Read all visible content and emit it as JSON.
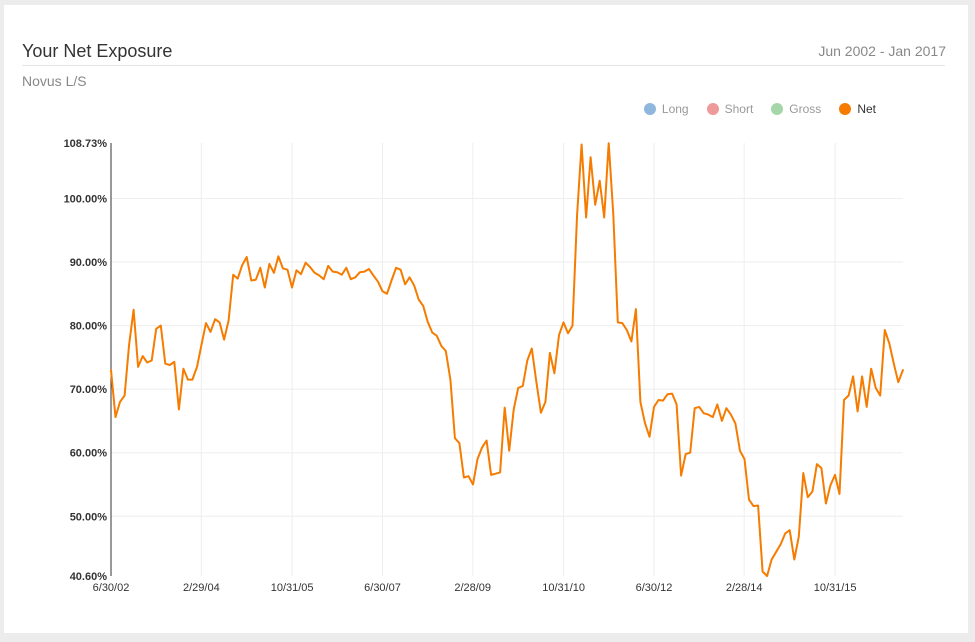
{
  "header": {
    "title": "Your Net Exposure",
    "date_range": "Jun 2002 - Jan 2017",
    "subtitle": "Novus L/S"
  },
  "legend": [
    {
      "label": "Long",
      "color": "#8fb6dd",
      "active": false
    },
    {
      "label": "Short",
      "color": "#ef9a9a",
      "active": false
    },
    {
      "label": "Gross",
      "color": "#a5d6a7",
      "active": false
    },
    {
      "label": "Net",
      "color": "#f57c00",
      "active": true
    }
  ],
  "chart_data": {
    "type": "line",
    "y_ticks": [
      "108.73%",
      "100.00%",
      "90.00%",
      "80.00%",
      "70.00%",
      "60.00%",
      "50.00%",
      "40.60%"
    ],
    "y_tick_values": [
      108.73,
      100,
      90,
      80,
      70,
      60,
      50,
      40.6
    ],
    "ylim": [
      40.6,
      108.73
    ],
    "x_ticks": [
      "6/30/02",
      "2/29/04",
      "10/31/05",
      "6/30/07",
      "2/28/09",
      "10/31/10",
      "6/30/12",
      "2/28/14",
      "10/31/15"
    ],
    "xlim": [
      "2002-06-30",
      "2017-01-31"
    ],
    "grid": true,
    "series": [
      {
        "name": "Net",
        "color": "#f57c00",
        "x": [
          "2002-06",
          "2002-07",
          "2002-08",
          "2002-09",
          "2002-10",
          "2002-11",
          "2002-12",
          "2003-01",
          "2003-02",
          "2003-03",
          "2003-04",
          "2003-05",
          "2003-06",
          "2003-07",
          "2003-08",
          "2003-09",
          "2003-10",
          "2003-11",
          "2003-12",
          "2004-01",
          "2004-02",
          "2004-03",
          "2004-04",
          "2004-05",
          "2004-06",
          "2004-07",
          "2004-08",
          "2004-09",
          "2004-10",
          "2004-11",
          "2004-12",
          "2005-01",
          "2005-02",
          "2005-03",
          "2005-04",
          "2005-05",
          "2005-06",
          "2005-07",
          "2005-08",
          "2005-09",
          "2005-10",
          "2005-11",
          "2005-12",
          "2006-01",
          "2006-02",
          "2006-03",
          "2006-04",
          "2006-05",
          "2006-06",
          "2006-07",
          "2006-08",
          "2006-09",
          "2006-10",
          "2006-11",
          "2006-12",
          "2007-01",
          "2007-02",
          "2007-03",
          "2007-04",
          "2007-05",
          "2007-06",
          "2007-07",
          "2007-08",
          "2007-09",
          "2007-10",
          "2007-11",
          "2007-12",
          "2008-01",
          "2008-02",
          "2008-03",
          "2008-04",
          "2008-05",
          "2008-06",
          "2008-07",
          "2008-08",
          "2008-09",
          "2008-10",
          "2008-11",
          "2008-12",
          "2009-01",
          "2009-02",
          "2009-03",
          "2009-04",
          "2009-05",
          "2009-06",
          "2009-07",
          "2009-08",
          "2009-09",
          "2009-10",
          "2009-11",
          "2009-12",
          "2010-01",
          "2010-02",
          "2010-03",
          "2010-04",
          "2010-05",
          "2010-06",
          "2010-07",
          "2010-08",
          "2010-09",
          "2010-10",
          "2010-11",
          "2010-12",
          "2011-01",
          "2011-02",
          "2011-03",
          "2011-04",
          "2011-05",
          "2011-06",
          "2011-07",
          "2011-08",
          "2011-09",
          "2011-10",
          "2011-11",
          "2011-12",
          "2012-01",
          "2012-02",
          "2012-03",
          "2012-04",
          "2012-05",
          "2012-06",
          "2012-07",
          "2012-08",
          "2012-09",
          "2012-10",
          "2012-11",
          "2012-12",
          "2013-01",
          "2013-02",
          "2013-03",
          "2013-04",
          "2013-05",
          "2013-06",
          "2013-07",
          "2013-08",
          "2013-09",
          "2013-10",
          "2013-11",
          "2013-12",
          "2014-01",
          "2014-02",
          "2014-03",
          "2014-04",
          "2014-05",
          "2014-06",
          "2014-07",
          "2014-08",
          "2014-09",
          "2014-10",
          "2014-11",
          "2014-12",
          "2015-01",
          "2015-02",
          "2015-03",
          "2015-04",
          "2015-05",
          "2015-06",
          "2015-07",
          "2015-08",
          "2015-09",
          "2015-10",
          "2015-11",
          "2015-12",
          "2016-01",
          "2016-02",
          "2016-03",
          "2016-04",
          "2016-05",
          "2016-06",
          "2016-07",
          "2016-08",
          "2016-09",
          "2016-10",
          "2016-11",
          "2016-12",
          "2017-01"
        ],
        "values": [
          73.0,
          65.6,
          68.0,
          69.0,
          77.0,
          82.5,
          73.5,
          75.2,
          74.2,
          74.5,
          79.5,
          80.0,
          74.0,
          73.8,
          74.3,
          66.8,
          73.2,
          71.5,
          71.5,
          73.5,
          77.0,
          80.4,
          79.0,
          81.0,
          80.5,
          77.8,
          80.8,
          88.0,
          87.4,
          89.5,
          90.8,
          87.1,
          87.2,
          89.1,
          86.0,
          89.7,
          88.3,
          90.9,
          89.0,
          88.8,
          86.0,
          88.7,
          88.1,
          89.9,
          89.2,
          88.3,
          87.9,
          87.3,
          89.4,
          88.5,
          88.4,
          88.0,
          89.1,
          87.3,
          87.6,
          88.4,
          88.5,
          88.9,
          87.9,
          86.9,
          85.4,
          85.0,
          87.1,
          89.1,
          88.8,
          86.5,
          87.6,
          86.3,
          84.1,
          83.1,
          80.6,
          78.9,
          78.4,
          76.8,
          76.0,
          71.5,
          62.3,
          61.5,
          56.1,
          56.3,
          55.0,
          59.0,
          60.8,
          61.9,
          56.5,
          56.7,
          56.9,
          67.1,
          60.3,
          66.8,
          70.2,
          70.5,
          74.5,
          76.4,
          71.2,
          66.3,
          68.0,
          75.7,
          72.5,
          78.5,
          80.5,
          78.8,
          80.0,
          97.5,
          108.5,
          97.0,
          106.5,
          99.0,
          102.8,
          97.0,
          108.7,
          97.5,
          80.5,
          80.4,
          79.3,
          77.5,
          82.6,
          68.0,
          64.7,
          62.5,
          67.2,
          68.3,
          68.2,
          69.2,
          69.3,
          67.6,
          56.4,
          59.8,
          60.0,
          67.0,
          67.2,
          66.2,
          66.0,
          65.6,
          67.6,
          65.0,
          67.0,
          66.0,
          64.6,
          60.3,
          59.0,
          52.6,
          51.6,
          51.7,
          41.3,
          40.6,
          43.2,
          44.4,
          45.6,
          47.3,
          47.8,
          43.2,
          46.8,
          56.8,
          53.0,
          53.9,
          58.2,
          57.6,
          52.0,
          54.9,
          56.5,
          53.5,
          68.3,
          69.0,
          72.0,
          66.5,
          72.0,
          67.2,
          73.2,
          70.2,
          69.0,
          79.3,
          77.2,
          74.0,
          71.1,
          73.0
        ]
      }
    ]
  }
}
